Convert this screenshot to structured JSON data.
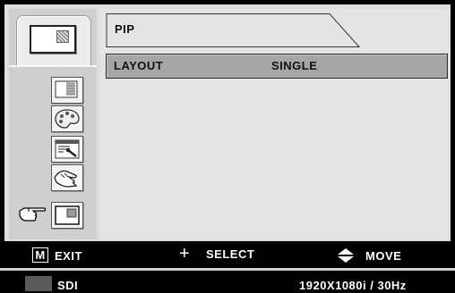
{
  "menu": {
    "title": "PIP",
    "rows": [
      {
        "label": "LAYOUT",
        "value": "SINGLE"
      }
    ]
  },
  "sidebar": {
    "items": [
      {
        "icon": "pip-window-icon",
        "selected": true
      },
      {
        "icon": "picture-icon"
      },
      {
        "icon": "color-palette-icon"
      },
      {
        "icon": "settings-window-icon"
      },
      {
        "icon": "hand-icon"
      },
      {
        "icon": "pip-icon",
        "pointed": true
      }
    ],
    "pointer_icon": "pointing-hand-icon"
  },
  "footer": {
    "menu_key": "M",
    "exit_label": "EXIT",
    "select_label": "SELECT",
    "move_label": "MOVE"
  },
  "status": {
    "source": "SDI",
    "resolution": "1920X1080i / 30Hz"
  },
  "colors": {
    "panel_bg": "#dedede",
    "highlight_row": "#a6a6a6",
    "bar_bg": "#000000",
    "text_dark": "#111111",
    "text_light": "#ffffff"
  }
}
